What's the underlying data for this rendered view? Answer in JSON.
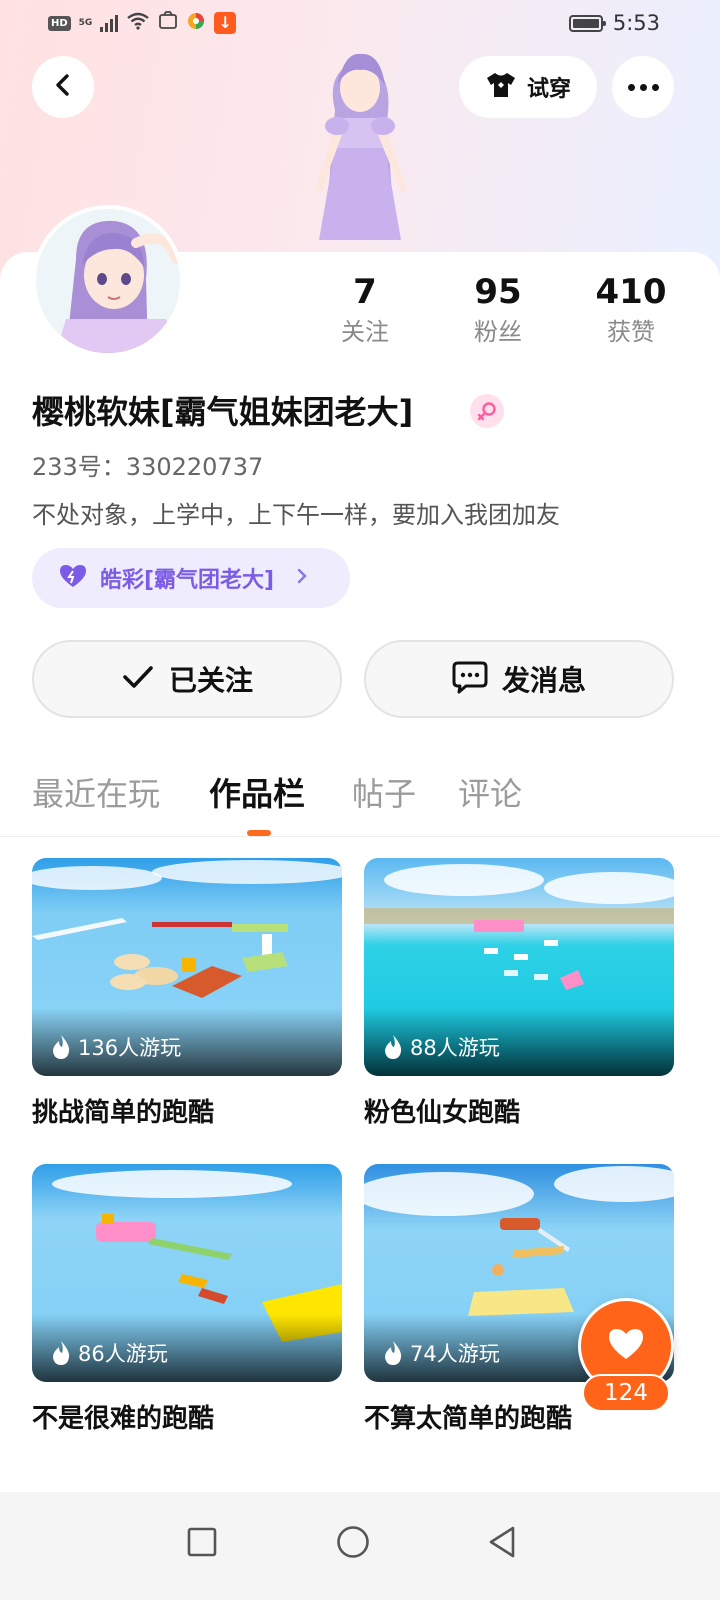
{
  "status_bar": {
    "hd": "HD",
    "network": "5G",
    "time": "5:53"
  },
  "header": {
    "tryon_label": "试穿"
  },
  "profile": {
    "stats": [
      {
        "value": "7",
        "label": "关注"
      },
      {
        "value": "95",
        "label": "粉丝"
      },
      {
        "value": "410",
        "label": "获赞"
      }
    ],
    "nickname": "樱桃软妹[霸气姐妹团老大]",
    "gender": "female",
    "uid": "233号：330220737",
    "bio": "不处对象，上学中，上下午一样，要加入我团加友",
    "group": "皓彩[霸气团老大]",
    "follow_label": "已关注",
    "message_label": "发消息"
  },
  "tabs": [
    "最近在玩",
    "作品栏",
    "帖子",
    "评论"
  ],
  "active_tab": 1,
  "works": [
    {
      "plays": "136人游玩",
      "title": "挑战简单的跑酷"
    },
    {
      "plays": "88人游玩",
      "title": "粉色仙女跑酷"
    },
    {
      "plays": "86人游玩",
      "title": "不是很难的跑酷"
    },
    {
      "plays": "74人游玩",
      "title": "不算太简单的跑酷"
    }
  ],
  "like": {
    "count": "124"
  },
  "colors": {
    "accent": "#ff6418",
    "group_purple": "#7c5ce6",
    "gender_pink": "#ff5d9e"
  },
  "icons": {
    "back": "chevron-left-icon",
    "tryon": "tshirt-icon",
    "more": "more-dots-icon",
    "follow": "check-icon",
    "message": "chat-bubble-icon",
    "group": "purple-heart-icon",
    "plays": "flame-icon",
    "like": "heart-icon"
  }
}
